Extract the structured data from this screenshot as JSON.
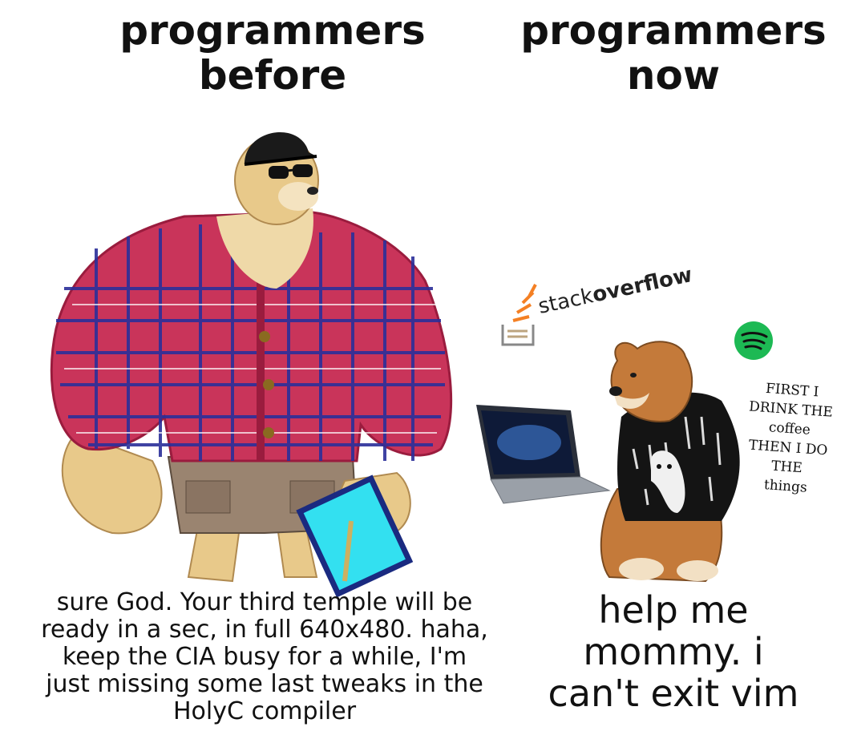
{
  "left": {
    "title": "programmers\nbefore",
    "caption": "sure God. Your third temple will be\nready in a sec, in full 640x480. haha,\nkeep the CIA busy for a while, I'm\njust missing some last tweaks in the\nHolyC compiler"
  },
  "right": {
    "title": "programmers\nnow",
    "caption": "help me\nmommy. i\ncan't exit vim",
    "stackoverflow_prefix": "stack",
    "stackoverflow_suffix": "overflow",
    "coffee_sticker": "FIRST I DRINK THE\ncoffee\nTHEN I DO THE\nthings"
  },
  "colors": {
    "shirt": "#c9345a",
    "plaid": "#2b2f9a",
    "doge_fur": "#e8c98a",
    "cheems_fur": "#c47a3a",
    "sweater": "#111111",
    "spotify": "#1db954",
    "stackoverflow_orange": "#f48024"
  },
  "icons": [
    "stackoverflow-logo-icon",
    "spotify-icon",
    "laptop-icon",
    "sunglasses-icon",
    "cap-icon",
    "pencil-icon"
  ]
}
